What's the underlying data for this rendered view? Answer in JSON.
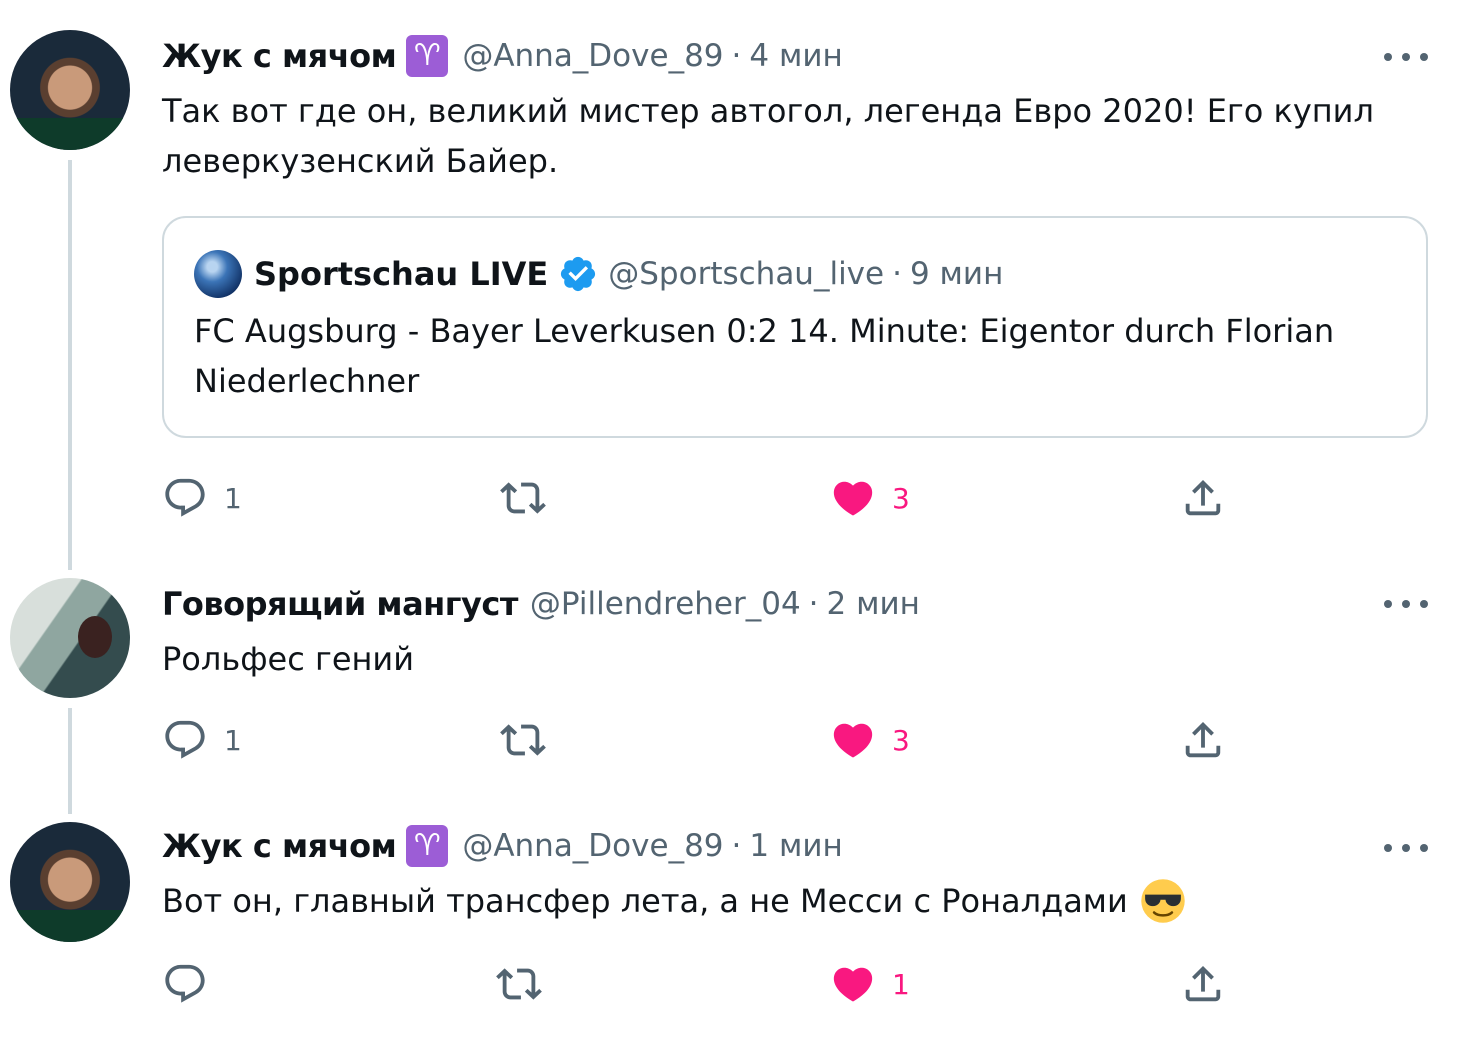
{
  "tweets": [
    {
      "display_name": "Жук с мячом",
      "badge": "aries-emoji",
      "handle": "@Anna_Dove_89",
      "separator": "·",
      "time": "4 мин",
      "text_lines": [
        "Так вот где он, великий мистер автогол, легенда Евро 2020! Его купил",
        "леверкузенский Байер."
      ],
      "quote": {
        "display_name": "Sportschau LIVE",
        "verified": true,
        "handle": "@Sportschau_live",
        "separator": "·",
        "time": "9 мин",
        "text_lines": [
          "FC Augsburg - Bayer Leverkusen 0:2 14. Minute: Eigentor durch Florian",
          "Niederlechner"
        ]
      },
      "actions": {
        "replies": "1",
        "retweets": "",
        "likes": "3"
      }
    },
    {
      "display_name": "Говорящий мангуст",
      "handle": "@Pillendreher_04",
      "separator": "·",
      "time": "2 мин",
      "text": "Рольфес гений",
      "actions": {
        "replies": "1",
        "retweets": "",
        "likes": "3"
      }
    },
    {
      "display_name": "Жук с мячом",
      "badge": "aries-emoji",
      "handle": "@Anna_Dove_89",
      "separator": "·",
      "time": "1 мин",
      "text": "Вот он, главный трансфер лета, а не Месси с Роналдами",
      "emoji": "sunglasses-emoji",
      "actions": {
        "replies": "",
        "retweets": "",
        "likes": "1"
      }
    }
  ],
  "colors": {
    "text": "#0f1419",
    "muted": "#536471",
    "like": "#f91880",
    "border": "#cfd9de",
    "verified": "#1d9bf0",
    "aries_badge": "#9c5dd6"
  }
}
